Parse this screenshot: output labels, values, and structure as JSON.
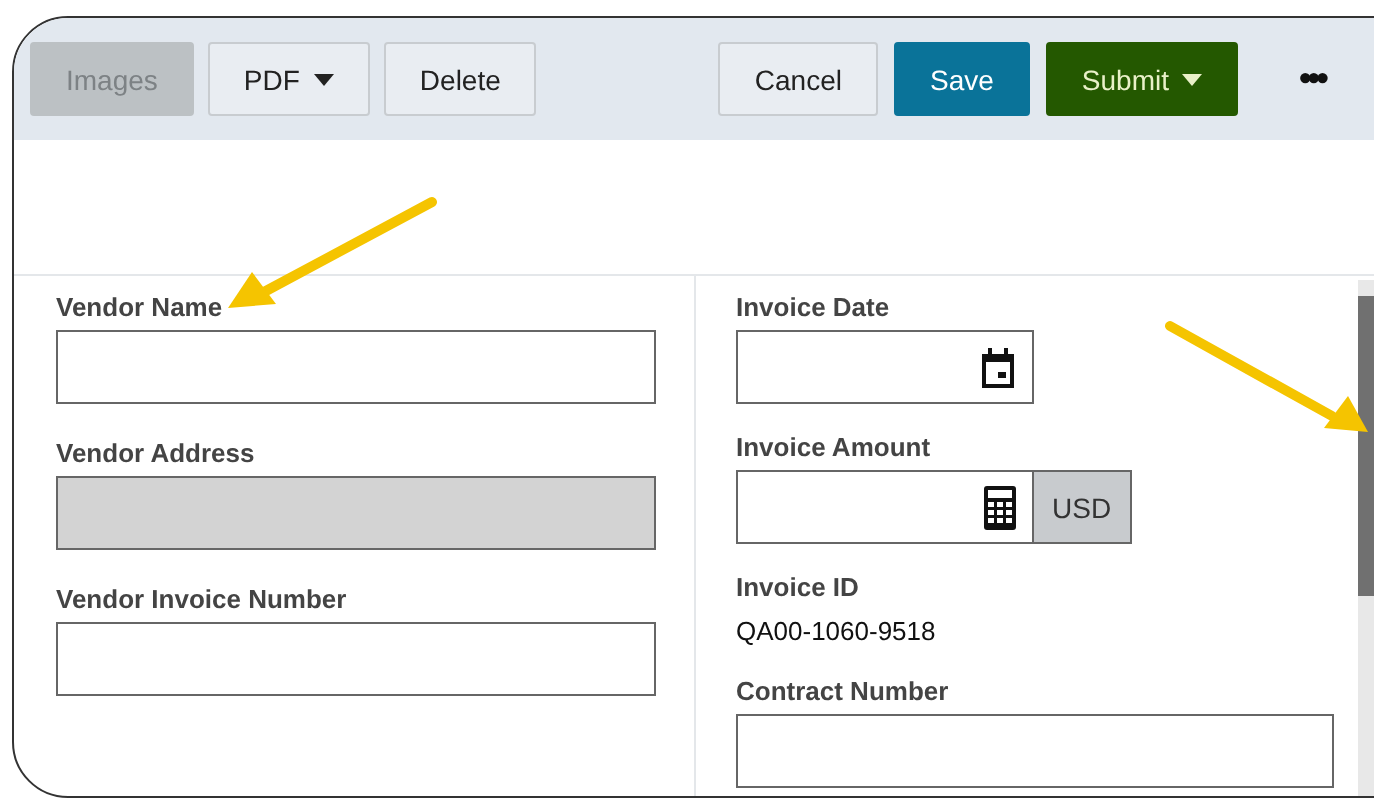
{
  "toolbar": {
    "left_buttons": [
      {
        "label": "Images",
        "kind": "plain",
        "disabled": true
      },
      {
        "label": "PDF",
        "kind": "dropdown",
        "disabled": false
      },
      {
        "label": "Delete",
        "kind": "plain",
        "disabled": false
      }
    ],
    "right_buttons": [
      {
        "label": "Cancel",
        "kind": "plain",
        "disabled": false
      },
      {
        "label": "Save",
        "kind": "primary",
        "disabled": false
      },
      {
        "label": "Submit",
        "kind": "success-dropdown",
        "disabled": false
      },
      {
        "label": "•••",
        "kind": "more",
        "disabled": false
      }
    ]
  },
  "left_fields": [
    {
      "label": "Vendor Name",
      "kind": "text",
      "disabled": false
    },
    {
      "label": "Vendor Address",
      "kind": "text",
      "disabled": true
    },
    {
      "label": "Vendor Invoice Number",
      "kind": "text",
      "disabled": false
    }
  ],
  "right_fields": [
    {
      "label": "Invoice Date",
      "kind": "date",
      "disabled": false
    },
    {
      "label": "Invoice Amount",
      "kind": "amount",
      "disabled": false,
      "currency": "USD"
    },
    {
      "label": "Invoice ID",
      "kind": "readonly",
      "value": "QA00-1060-9518"
    },
    {
      "label": "Contract Number",
      "kind": "wide",
      "disabled": false
    }
  ]
}
